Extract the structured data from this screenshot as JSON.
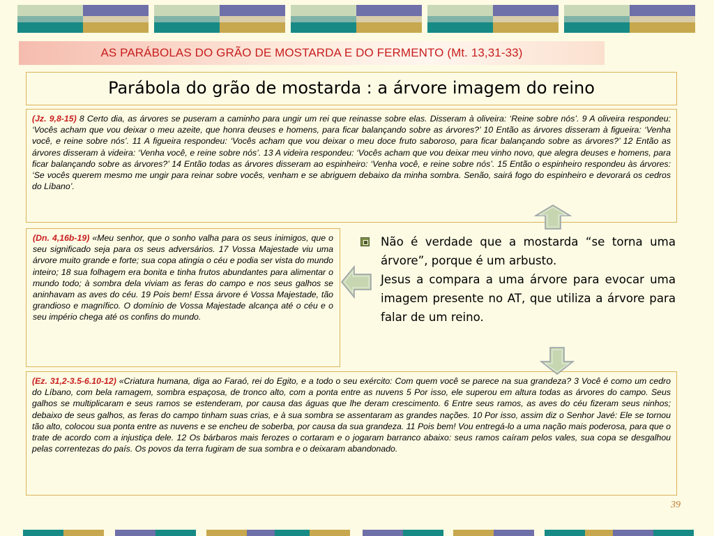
{
  "colors": {
    "accent_red": "#c81e1e",
    "box_border": "#d9b35a",
    "background": "#fdfbe4",
    "arrow_fill": "#c6d6b0",
    "page_number": "#c07a30"
  },
  "header": {
    "title": "AS PARÁBOLAS DO GRÃO DE MOSTARDA E DO FERMENTO (Mt. 13,31-33)"
  },
  "slide": {
    "title": "Parábola do grão de mostarda : a árvore imagem do reino",
    "page_number": "39"
  },
  "passages": {
    "judges": {
      "ref": "(Jz. 9,8-15)",
      "text": " 8 Certo dia, as árvores se puseram a caminho para ungir um rei que reinasse sobre elas. Disseram à oliveira: ‘Reine sobre nós’. 9 A oliveira respondeu: ‘Vocês acham que vou deixar o meu azeite, que honra deuses e homens, para ficar balançando sobre as árvores?’ 10 Então as árvores disseram à figueira: ‘Venha você, e reine sobre nós’. 11 A figueira respondeu: ‘Vocês acham que vou deixar o meu doce fruto saboroso, para ficar balançando sobre as árvores?’ 12 Então as árvores disseram à videira: ‘Venha você, e reine sobre nós’. 13 A videira respondeu: ‘Vocês acham que vou deixar meu vinho novo, que alegra deuses e homens, para ficar balançando sobre as árvores?’ 14 Então todas as árvores disseram ao espinheiro: ‘Venha você, e reine sobre nós’. 15 Então o espinheiro respondeu às árvores: ‘Se vocês querem mesmo me ungir para reinar sobre vocês, venham e se abriguem debaixo da minha sombra. Senão, sairá fogo do espinheiro e devorará os cedros do Líbano’."
    },
    "daniel": {
      "ref": "(Dn. 4,16b-19)",
      "text": " «Meu senhor, que o sonho valha para os seus inimigos, que o seu significado seja para os seus adversários. 17 Vossa Majestade viu uma árvore muito grande e forte; sua copa atingia o céu e podia ser vista do mundo inteiro; 18 sua folhagem era bonita e tinha frutos abundantes para alimentar o mundo todo; à sombra dela viviam as feras do campo e nos seus galhos se aninhavam as aves do céu. 19 Pois bem! Essa árvore é Vossa Majestade, tão grandioso e magnífico. O domínio de Vossa Majestade alcança até o céu e o seu império chega até os confins do mundo."
    },
    "ezekiel": {
      "ref": "(Ez. 31,2-3.5-6.10-12)",
      "text": " «Criatura humana, diga ao Faraó, rei do Egito, e a todo o seu exército: Com quem você se parece na sua grandeza? 3 Você é como um cedro do Líbano, com bela ramagem, sombra espaçosa, de tronco alto, com a ponta entre as nuvens 5 Por isso, ele superou em altura todas as árvores do campo. Seus galhos se multiplicaram e seus ramos se estenderam, por causa das águas que lhe deram crescimento. 6 Entre seus ramos, as aves do céu fizeram seus ninhos; debaixo de seus galhos, as feras do campo tinham suas crias, e à sua sombra se assentaram as grandes nações. 10 Por isso, assim diz o Senhor Javé: Ele se tornou tão alto, colocou sua ponta entre as nuvens e se encheu de soberba, por causa da sua grandeza. 11 Pois bem! Vou entregá-lo a uma nação mais poderosa, para que o trate de acordo com a injustiça dele. 12 Os bárbaros mais ferozes o cortaram e o jogaram barranco abaixo: seus ramos caíram pelos vales, sua copa se desgalhou pelas correntezas do país. Os povos da terra fugiram de sua sombra e o deixaram abandonado."
    }
  },
  "bullets": [
    {
      "icon": "square-bullet-icon",
      "text": "Não é verdade que a mostarda “se torna uma árvore”, porque é um arbusto."
    },
    {
      "icon": "square-bullet-icon",
      "text": "Jesus a compara a uma árvore para evocar uma imagem presente no AT, que utiliza a árvore para falar de um reino."
    }
  ],
  "arrows": [
    "arrow-up-icon",
    "arrow-left-icon",
    "arrow-down-icon"
  ]
}
